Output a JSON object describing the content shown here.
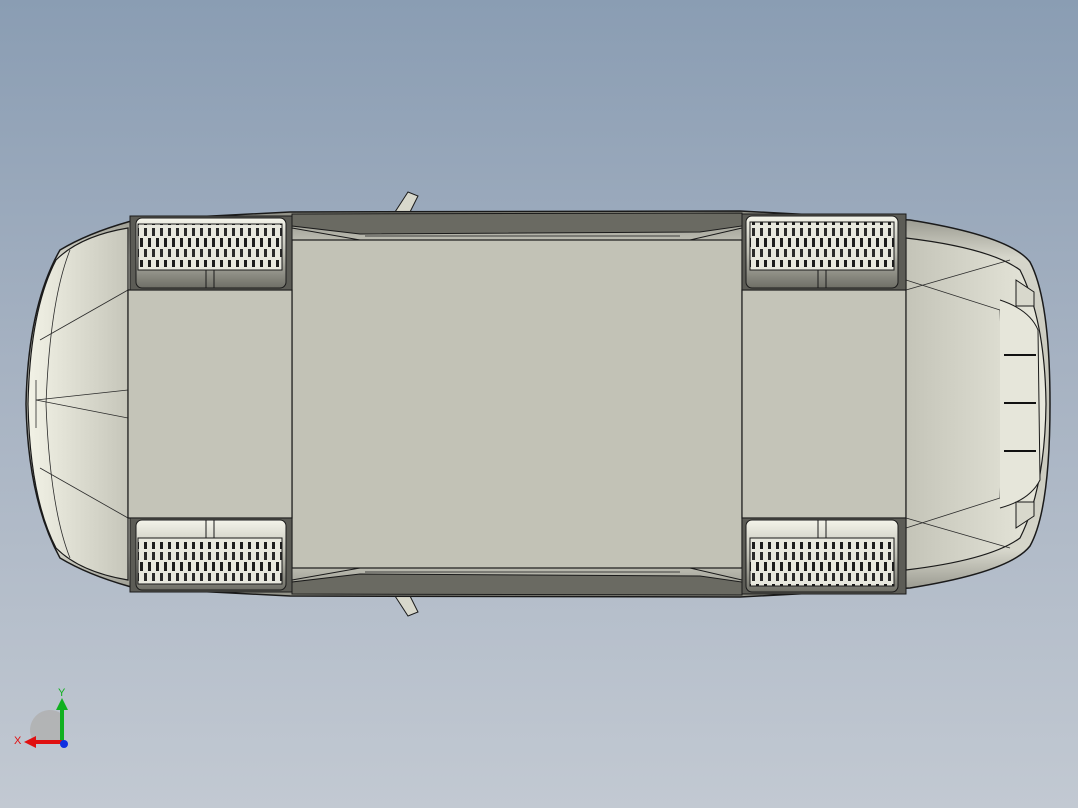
{
  "triad": {
    "x_label": "X",
    "y_label": "Y",
    "x_color": "#e01010",
    "y_color": "#10b020",
    "z_color": "#1030e0"
  },
  "colors": {
    "background_top": "#8a9db3",
    "background_bottom": "#c2c9d2",
    "body_fill": "#c4c4b8",
    "outline": "#1a1a1a"
  }
}
